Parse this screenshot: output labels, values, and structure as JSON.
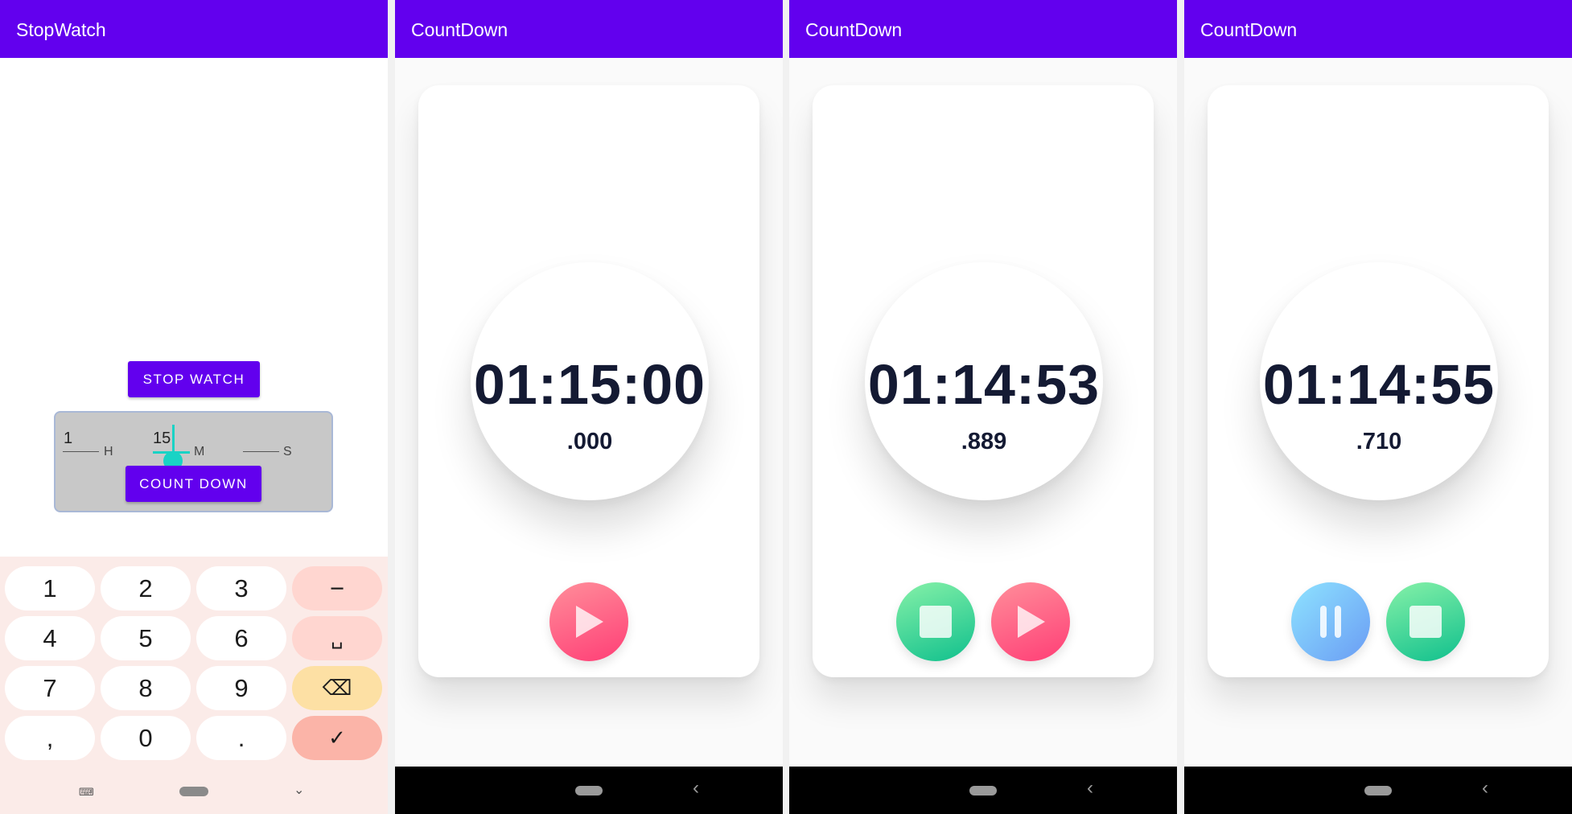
{
  "panel1": {
    "title": "StopWatch",
    "stopwatch_button": "STOP WATCH",
    "picker": {
      "hours_value": "1",
      "hours_unit": "H",
      "minutes_value": "15",
      "minutes_unit": "M",
      "seconds_value": "",
      "seconds_unit": "S"
    },
    "countdown_button": "COUNT DOWN",
    "keyboard": {
      "rows": [
        [
          "1",
          "2",
          "3",
          "−"
        ],
        [
          "4",
          "5",
          "6",
          "␣"
        ],
        [
          "7",
          "8",
          "9",
          "⌫"
        ],
        [
          ",",
          "0",
          ".",
          "✓"
        ]
      ],
      "nav": [
        "keyboard-switch-icon",
        "home-pill",
        "chevron-down-icon"
      ]
    }
  },
  "panels": [
    {
      "title": "CountDown",
      "time": "01:15:00",
      "millis": ".000",
      "buttons": [
        "play"
      ]
    },
    {
      "title": "CountDown",
      "time": "01:14:53",
      "millis": ".889",
      "buttons": [
        "stop",
        "play"
      ]
    },
    {
      "title": "CountDown",
      "time": "01:14:55",
      "millis": ".710",
      "buttons": [
        "pause",
        "stop"
      ]
    }
  ],
  "colors": {
    "appbar": "#6200ee",
    "play_gradient": [
      "#ff8e9a",
      "#ff3e76"
    ],
    "stop_gradient": [
      "#86f1a8",
      "#10c08d"
    ],
    "pause_gradient": [
      "#8ee3ff",
      "#6a9cf4"
    ],
    "time_text": "#141a33"
  }
}
